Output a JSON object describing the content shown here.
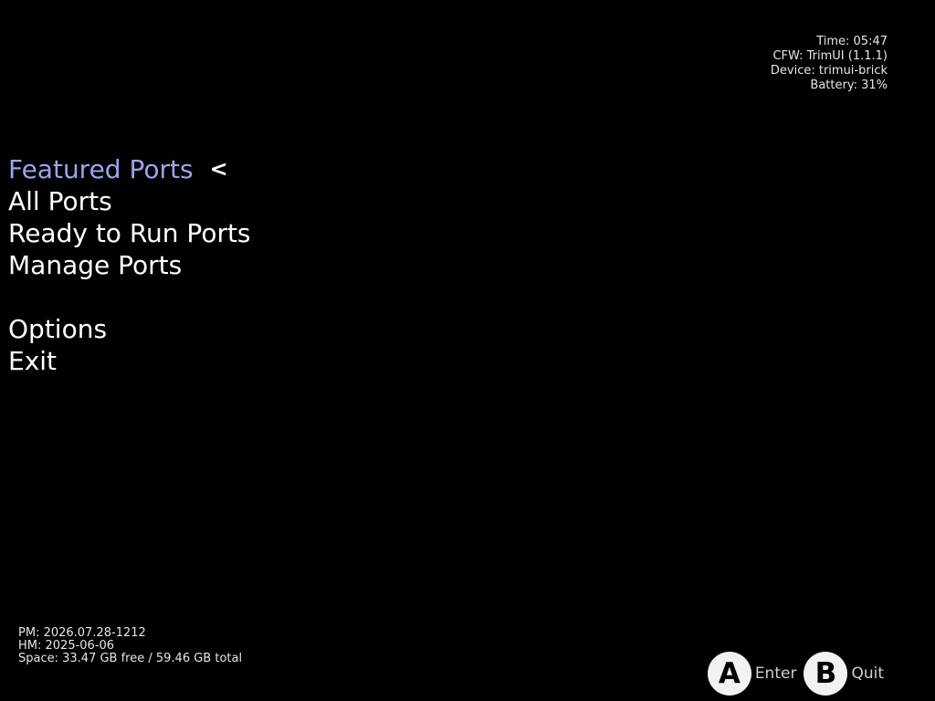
{
  "sysinfo": {
    "time": "Time: 05:47",
    "cfw": "CFW: TrimUI (1.1.1)",
    "device": "Device: trimui-brick",
    "battery": "Battery: 31%"
  },
  "menu": {
    "items": [
      {
        "label": "Featured Ports"
      },
      {
        "label": "All Ports"
      },
      {
        "label": "Ready to Run Ports"
      },
      {
        "label": "Manage Ports"
      },
      {
        "label": "Options"
      },
      {
        "label": "Exit"
      }
    ],
    "cursor_glyph": "<",
    "selected_color": "#9aa5ec"
  },
  "storage": {
    "pm": "PM: 2026.07.28-1212",
    "hm": "HM: 2025-06-06",
    "space": "Space: 33.47 GB free / 59.46 GB total"
  },
  "hints": {
    "a_button": "A",
    "a_label": "Enter",
    "b_button": "B",
    "b_label": "Quit"
  }
}
